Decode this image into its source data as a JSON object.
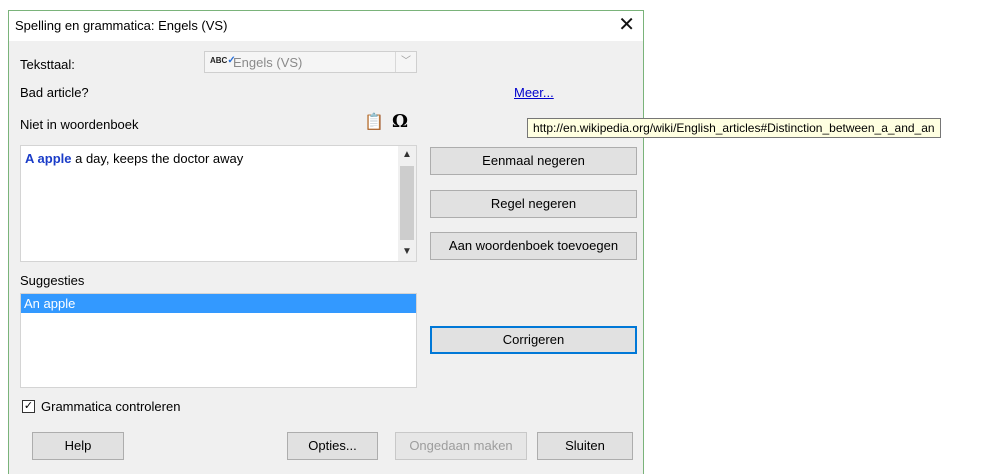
{
  "window": {
    "title": "Spelling en grammatica: Engels (VS)",
    "close_glyph": "✕"
  },
  "text_language": {
    "label": "Teksttaal:",
    "value": "Engels (VS)",
    "icon": "spellcheck-abc-icon",
    "icon_text": "ABC"
  },
  "error_type": "Bad article?",
  "more_link": "Meer...",
  "tooltip": "http://en.wikipedia.org/wiki/English_articles#Distinction_between_a_and_an",
  "not_in_dictionary": {
    "label": "Niet in woordenboek",
    "bad_text": "A apple",
    "rest_text": " a day, keeps the doctor away"
  },
  "toolbar_icons": [
    "paste-icon",
    "special-character-omega-icon"
  ],
  "suggestions": {
    "label": "Suggesties",
    "items": [
      "An apple"
    ],
    "selected_index": 0
  },
  "side_buttons": {
    "ignore_once": "Eenmaal negeren",
    "ignore_rule": "Regel negeren",
    "add_to_dictionary": "Aan woordenboek toevoegen",
    "correct": "Corrigeren"
  },
  "check_grammar": {
    "label": "Grammatica controleren",
    "checked": true
  },
  "bottom_buttons": {
    "help": "Help",
    "options": "Opties...",
    "undo": "Ongedaan maken",
    "close": "Sluiten"
  }
}
